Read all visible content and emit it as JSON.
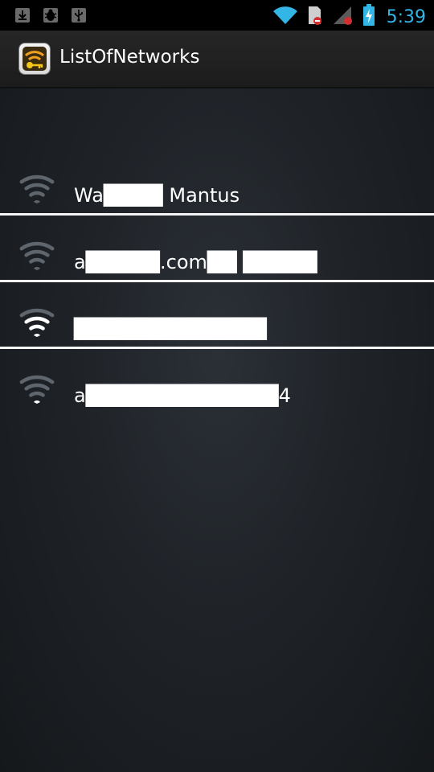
{
  "status_bar": {
    "time": "5:39",
    "left_icons": [
      "download-icon",
      "bug-icon",
      "usb-icon"
    ],
    "right_icons": [
      "wifi-signal-icon",
      "sd-card-icon",
      "cell-signal-icon",
      "battery-charging-icon"
    ]
  },
  "action_bar": {
    "app_icon": "wifi-key-icon",
    "title": "ListOfNetworks"
  },
  "networks": [
    {
      "ssid": "Wa████ Mantus",
      "signal": 0
    },
    {
      "ssid": "a█████.com██ █████",
      "signal": 0
    },
    {
      "ssid": "█████████████",
      "signal": 3
    },
    {
      "ssid": "a█████████████4",
      "signal": 1
    }
  ],
  "colors": {
    "clock": "#33b5e5",
    "wifi_active": "#ffffff",
    "wifi_inactive": "#5f656c",
    "divider": "#f4f4f4"
  }
}
